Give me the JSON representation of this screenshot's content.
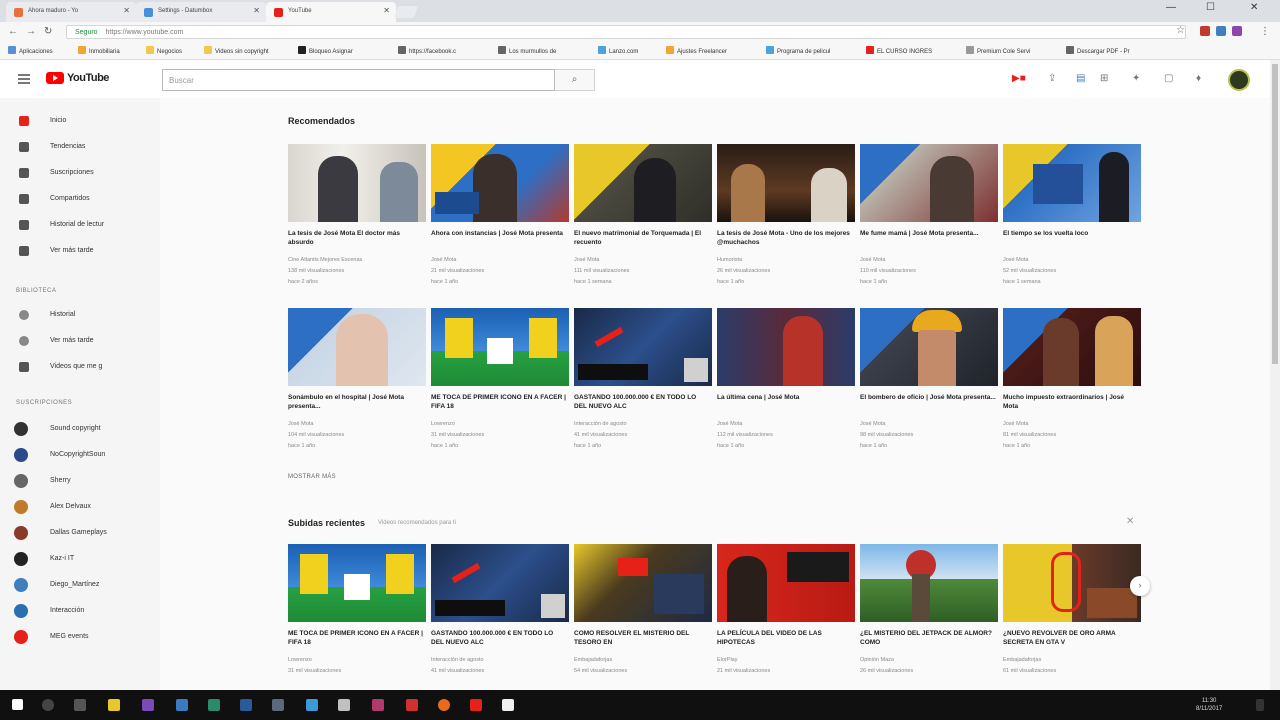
{
  "browser": {
    "tabs": [
      {
        "title": "Ahora maduro - Yo",
        "favicon": "#e8713b"
      },
      {
        "title": "Settings - Datumbox",
        "favicon": "#4a90d9"
      },
      {
        "title": "YouTube",
        "favicon": "#e62117"
      }
    ],
    "omnibox": {
      "secure_label": "Seguro",
      "url": "https://www.youtube.com"
    },
    "bookmarks": [
      {
        "label": "Aplicaciones",
        "color": "#5a8fd8"
      },
      {
        "label": "Inmobiliaria",
        "color": "#f2a533"
      },
      {
        "label": "Negocios",
        "color": "#f2c94c"
      },
      {
        "label": "Videos sin copyright",
        "color": "#f2c94c"
      },
      {
        "label": "Bloqueo Asignar",
        "color": "#222222"
      },
      {
        "label": "https://facebook.c",
        "color": "#666666"
      },
      {
        "label": "Los murmullos de",
        "color": "#666666"
      },
      {
        "label": "Lanzo.com",
        "color": "#4aa3df"
      },
      {
        "label": "Ajustes Freelancer",
        "color": "#f2a533"
      },
      {
        "label": "Programa de pelicul",
        "color": "#4aa3df"
      },
      {
        "label": "EL CURSO INGRES",
        "color": "#e62117"
      },
      {
        "label": "Premium Cole Servi",
        "color": "#999999"
      },
      {
        "label": "Descargar PDF - Pr",
        "color": "#666666"
      }
    ]
  },
  "masthead": {
    "logo_text": "YouTube",
    "search_placeholder": "Buscar"
  },
  "sidebar": {
    "main_items": [
      {
        "label": "Inicio",
        "icon": "home-icon",
        "active": true
      },
      {
        "label": "Tendencias",
        "icon": "trending-icon"
      },
      {
        "label": "Suscripciones",
        "icon": "subscriptions-icon"
      },
      {
        "label": "Compartidos",
        "icon": "shared-icon"
      },
      {
        "label": "Historial de lectur",
        "icon": "history-icon"
      },
      {
        "label": "Ver más tarde",
        "icon": "watch-later-icon"
      }
    ],
    "library_heading": "Biblioteca",
    "library_items": [
      {
        "label": "Historial",
        "icon": "history-icon"
      },
      {
        "label": "Ver más tarde",
        "icon": "clock-icon"
      },
      {
        "label": "Videos que me g",
        "icon": "thumbs-up-icon"
      }
    ],
    "subscriptions_heading": "Suscripciones",
    "subscriptions": [
      {
        "label": "Sound copyright",
        "color": "#333333"
      },
      {
        "label": "NoCopyrightSoun",
        "color": "#2b4a8b"
      },
      {
        "label": "Sherry",
        "color": "#666666"
      },
      {
        "label": "Alex Delvaux",
        "color": "#c07a2a"
      },
      {
        "label": "Dallas Gameplays",
        "color": "#8a3a2a"
      },
      {
        "label": "Kaz-i IT",
        "color": "#222222"
      },
      {
        "label": "Diego_Martínez",
        "color": "#3f7fbf"
      },
      {
        "label": "Interacción",
        "color": "#2a6fb0"
      },
      {
        "label": "MEG events",
        "color": "#e62117"
      }
    ]
  },
  "recommended": {
    "title": "Recomendados",
    "more_label": "MOSTRAR MÁS",
    "videos": [
      {
        "title": "La tesis de José Mota El doctor más absurdo",
        "channel": "Cine Atlantis Mejores Escenas",
        "views": "138 mil visualizaciones",
        "age": "hace 2 años"
      },
      {
        "title": "Ahora con instancias | José Mota presenta",
        "channel": "José Mota",
        "views": "21 mil visualizaciones",
        "age": "hace 1 año"
      },
      {
        "title": "El nuevo matrimonial de Torquemada | El recuento",
        "channel": "José Mota",
        "views": "111 mil visualizaciones",
        "age": "hace 1 semana"
      },
      {
        "title": "La tesis de José Mota - Uno de los mejores @muchachos",
        "channel": "Humorista",
        "views": "26 mil visualizaciones",
        "age": "hace 1 año"
      },
      {
        "title": "Me fume mamá | José Mota presenta...",
        "channel": "José Mota",
        "views": "110 mil visualizaciones",
        "age": "hace 1 año"
      },
      {
        "title": "El tiempo se los vuelta loco",
        "channel": "José Mota",
        "views": "52 mil visualizaciones",
        "age": "hace 1 semana"
      },
      {
        "title": "Sonámbulo en el hospital | José Mota presenta...",
        "channel": "José Mota",
        "views": "104 mil visualizaciones",
        "age": "hace 1 año"
      },
      {
        "title": "ME TOCA DE PRIMER ICONO EN A FACER | FIFA 18",
        "channel": "Lowrenzo",
        "views": "31 mil visualizaciones",
        "age": "hace 1 año"
      },
      {
        "title": "GASTANDO 100.000.000 € EN TODO LO DEL NUEVO ALC",
        "channel": "Interacción de agosto",
        "views": "41 mil visualizaciones",
        "age": "hace 1 año"
      },
      {
        "title": "La última cena | José Mota",
        "channel": "José Mota",
        "views": "112 mil visualizaciones",
        "age": "hace 1 año"
      },
      {
        "title": "El bombero de oficio | José Mota presenta...",
        "channel": "José Mota",
        "views": "98 mil visualizaciones",
        "age": "hace 1 año"
      },
      {
        "title": "Mucho impuesto extraordinarios | José Mota",
        "channel": "José Mota",
        "views": "81 mil visualizaciones",
        "age": "hace 1 año"
      }
    ]
  },
  "trending": {
    "title": "Subidas recientes",
    "subtitle": "Videos recomendados para ti",
    "videos": [
      {
        "title": "ME TOCA DE PRIMER ICONO EN A FACER | FIFA 18",
        "channel": "Lowrenzo",
        "views": "31 mil visualizaciones"
      },
      {
        "title": "GASTANDO 100.000.000 € EN TODO LO DEL NUEVO ALC",
        "channel": "Interacción de agosto",
        "views": "41 mil visualizaciones"
      },
      {
        "title": "COMO RESOLVER EL MISTERIO DEL TESORO EN",
        "channel": "Embajadaforjas",
        "views": "54 mil visualizaciones"
      },
      {
        "title": "LA PELÍCULA DEL VIDEO DE LAS HIPOTECAS",
        "channel": "ElorPlay",
        "views": "21 mil visualizaciones"
      },
      {
        "title": "¿EL MISTERIO DEL JETPACK DE ALMOR? COMO",
        "channel": "Opinión Maza",
        "views": "26 mil visualizaciones"
      },
      {
        "title": "¿NUEVO REVOLVER DE ORO ARMA SECRETA EN GTA V",
        "channel": "Embajadaforjas",
        "views": "61 mil visualizaciones"
      }
    ]
  },
  "tray": {
    "time": "11:30",
    "date": "8/11/2017"
  }
}
